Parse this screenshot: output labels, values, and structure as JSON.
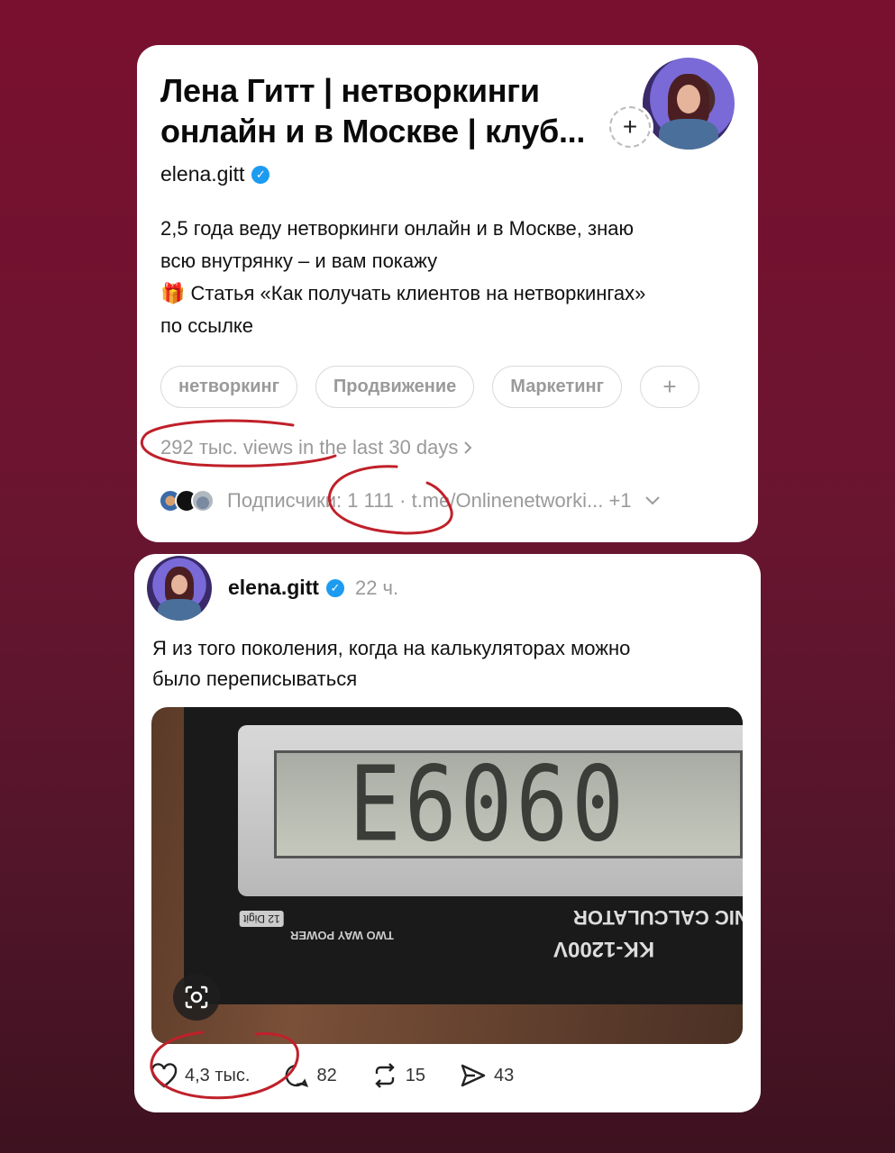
{
  "profile": {
    "title_line1": "Лена Гитт | нетворкинги",
    "title_line2": "онлайн и в Москве | клуб...",
    "username": "elena.gitt",
    "bio_line1": "2,5 года веду нетворкинги онлайн и в Москве, знаю",
    "bio_line2": "всю внутрянку – и вам покажу",
    "bio_line3": "🎁 Статья «Как получать клиентов на нетворкингах»",
    "bio_line4": "по ссылке",
    "tags": [
      "нетворкинг",
      "Продвижение",
      "Маркетинг"
    ],
    "add_tag": "+",
    "views": "292 тыс. views in the last 30 days",
    "followers": "Подписчики: 1 111 · t.me/Onlinenetworki... +1"
  },
  "post": {
    "username": "elena.gitt",
    "time": "22 ч.",
    "text_line1": "Я из того поколения, когда на калькуляторах можно",
    "text_line2": "было переписываться",
    "image": {
      "display": "E6060",
      "label_brand": "ONIC CALCULATOR",
      "label_model": "KK-1200V",
      "label_power": "TWO WAY POWER",
      "label_digits": "12 Digit"
    },
    "likes": "4,3 тыс.",
    "comments": "82",
    "reposts": "15",
    "shares": "43"
  },
  "colors": {
    "background": "#7a1030",
    "verified": "#1d9bf0",
    "annotation": "#c0202a"
  }
}
